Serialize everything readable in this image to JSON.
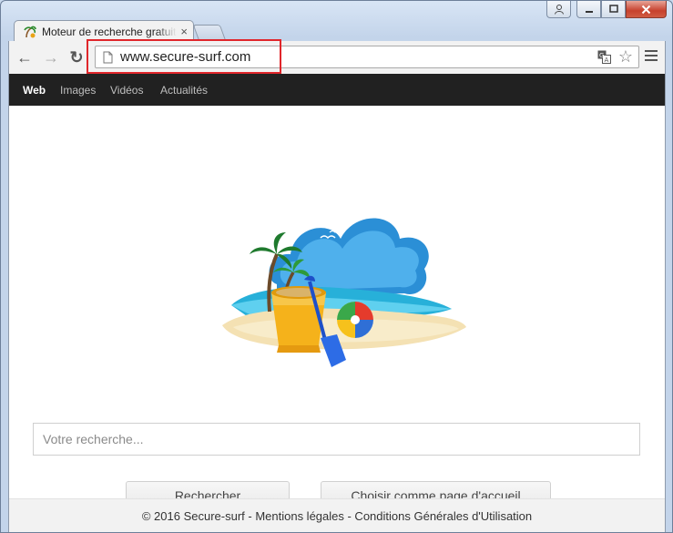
{
  "window": {
    "caption_user_icon": "user-icon",
    "caption_min_icon": "minimize-icon",
    "caption_max_icon": "maximize-icon",
    "caption_close_icon": "close-icon"
  },
  "tab": {
    "title": "Moteur de recherche gratuit",
    "close_glyph": "×"
  },
  "toolbar": {
    "back_glyph": "←",
    "forward_glyph": "→",
    "reload_glyph": "↻",
    "url": "www.secure-surf.com",
    "star_glyph": "☆"
  },
  "nav": {
    "items": [
      "Web",
      "Images",
      "Vidéos",
      "Actualités"
    ],
    "active": "Web"
  },
  "search": {
    "placeholder": "Votre recherche...",
    "value": ""
  },
  "buttons": {
    "search_label": "Rechercher",
    "homepage_label": "Choisir comme page d'accueil"
  },
  "footer": {
    "text": "© 2016 Secure-surf - Mentions légales - Conditions Générales d'Utilisation"
  },
  "colors": {
    "navbar_bg": "#212121",
    "highlight_border": "#e0262b",
    "page_bg": "#ffffff"
  }
}
